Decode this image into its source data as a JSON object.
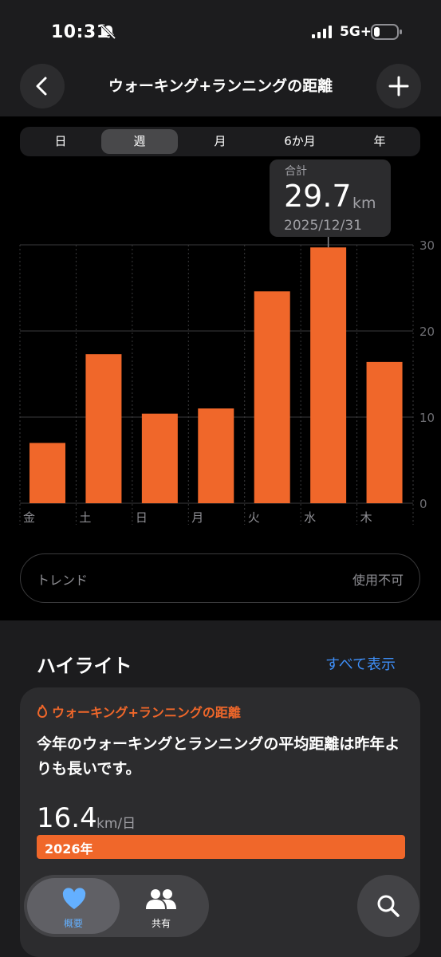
{
  "status": {
    "time": "10:31",
    "network": "5G+"
  },
  "header": {
    "title": "ウォーキング+ランニングの距離"
  },
  "segments": [
    "日",
    "週",
    "月",
    "6か月",
    "年"
  ],
  "selected_segment": "週",
  "tooltip": {
    "label": "合計",
    "value": "29.7",
    "unit": "km",
    "date": "2025/12/31"
  },
  "chart_data": {
    "type": "bar",
    "categories": [
      "金",
      "土",
      "日",
      "月",
      "火",
      "水",
      "木"
    ],
    "values": [
      7,
      17.3,
      10.4,
      11,
      24.6,
      29.7,
      16.4
    ],
    "ylim": [
      0,
      30
    ],
    "yticks": [
      "0",
      "10",
      "20",
      "30"
    ],
    "color": "#f0672a",
    "selected_index": 5
  },
  "trend": {
    "label": "トレンド",
    "value": "使用不可"
  },
  "highlights": {
    "title": "ハイライト",
    "see_all": "すべて表示",
    "card": {
      "tag": "ウォーキング+ランニングの距離",
      "text": "今年のウォーキングとランニングの平均距離は昨年よりも長いです。",
      "value": "16.4",
      "unit": "km/日",
      "bar_label": "2026年"
    }
  },
  "tabbar": {
    "summary": "概要",
    "sharing": "共有"
  },
  "colors": {
    "accent": "#f0672a",
    "link": "#3e8ef7",
    "tab_active": "#64b0ff"
  }
}
